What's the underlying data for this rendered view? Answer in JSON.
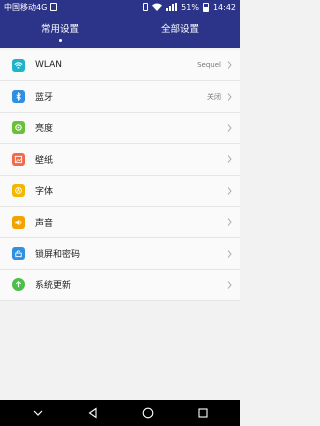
{
  "status_bar": {
    "carrier": "中国移动4G",
    "battery": "51%",
    "time": "14:42"
  },
  "tabs": [
    {
      "label": "常用设置",
      "active": true
    },
    {
      "label": "全部设置",
      "active": false
    }
  ],
  "settings": [
    {
      "label": "WLAN",
      "value": "Sequel",
      "icon": "wifi-icon",
      "color": "#1fb3c9"
    },
    {
      "label": "蓝牙",
      "value": "关闭",
      "icon": "bluetooth-icon",
      "color": "#2f8fe5"
    },
    {
      "label": "亮度",
      "value": "",
      "icon": "gear-icon",
      "color": "#6cbf3b"
    },
    {
      "label": "壁纸",
      "value": "",
      "icon": "wallpaper-icon",
      "color": "#f06a4a"
    },
    {
      "label": "字体",
      "value": "",
      "icon": "font-icon",
      "color": "#f2b800"
    },
    {
      "label": "声音",
      "value": "",
      "icon": "speaker-icon",
      "color": "#f2a300"
    },
    {
      "label": "锁屏和密码",
      "value": "",
      "icon": "lock-icon",
      "color": "#2f8fe5"
    },
    {
      "label": "系统更新",
      "value": "",
      "icon": "update-icon",
      "color": "#4cbf4a"
    }
  ],
  "colors": {
    "header": "#2b3488",
    "chevron": "#b0b0b0"
  }
}
